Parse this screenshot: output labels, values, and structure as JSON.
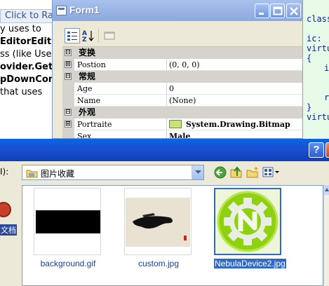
{
  "background_page": {
    "link_text": "Click to Ra",
    "lines": [
      "y uses to",
      "EditorEditS",
      "ss (like Use",
      "ovider.Get",
      "pDownCon",
      "that uses"
    ]
  },
  "background_code": {
    "lines": [
      "class",
      "",
      "ic:",
      "virtu",
      "{",
      "i",
      "",
      "",
      "r",
      "}",
      "virtu"
    ]
  },
  "form_window": {
    "title": "Form1",
    "property_grid": {
      "rows": [
        {
          "kind": "category",
          "expander": "⊟",
          "name": "变换"
        },
        {
          "kind": "property",
          "expander": "⊞",
          "name": "Postion",
          "value": "(0, 0, 0)",
          "bold": false
        },
        {
          "kind": "category",
          "expander": "⊟",
          "name": "常规"
        },
        {
          "kind": "property",
          "expander": "",
          "name": "Age",
          "value": "0",
          "bold": false
        },
        {
          "kind": "property",
          "expander": "",
          "name": "Name",
          "value": "(None)",
          "bold": false
        },
        {
          "kind": "category",
          "expander": "⊟",
          "name": "外观"
        },
        {
          "kind": "property",
          "expander": "⊞",
          "name": "Portraite",
          "value": "System.Drawing.Bitmap",
          "bold": true,
          "thumbnail": true
        },
        {
          "kind": "property",
          "expander": "",
          "name": "Sex",
          "value": "Male",
          "bold": true
        }
      ]
    }
  },
  "file_dialog": {
    "help_label": "?",
    "look_in_label": "I):",
    "look_in_value": "图片收藏",
    "places_label": "文档",
    "files": [
      {
        "name": "background.gif",
        "selected": false
      },
      {
        "name": "custom.jpg",
        "selected": false
      },
      {
        "name": "NebulaDevice2.jpg",
        "selected": true
      }
    ]
  },
  "colors": {
    "link": "#1c3d9f",
    "selection": "#316ac5",
    "xp_title_blue": "#0a5ae0",
    "nebula_green": "#8fd10c"
  },
  "icons": {
    "window_app": "form-window-icon",
    "minimize": "minimize-icon",
    "maximize": "maximize-icon",
    "close": "close-icon",
    "categorized": "categorized-icon",
    "alphabetical": "alphabetical-sort-icon",
    "property_pages": "property-pages-icon",
    "back": "back-arrow-icon",
    "up": "up-folder-icon",
    "new_folder": "new-folder-icon",
    "views": "views-menu-icon"
  }
}
